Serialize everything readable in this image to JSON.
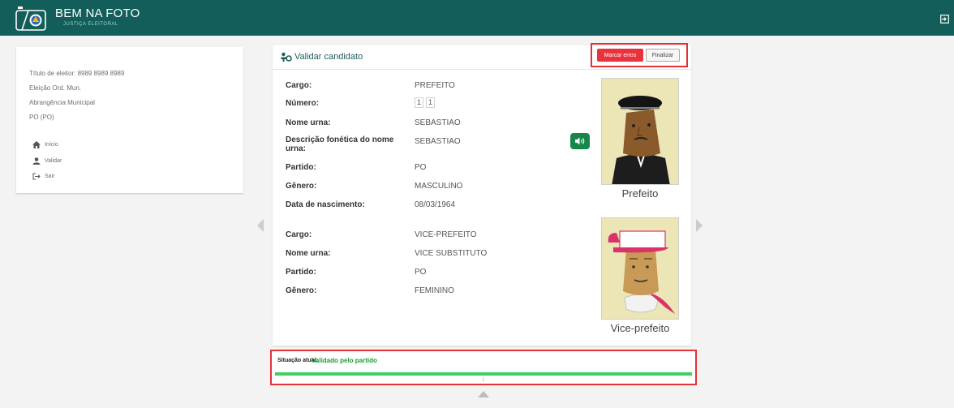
{
  "header": {
    "app_title": "BEM NA FOTO",
    "app_subtitle": "JUSTIÇA ELEITORAL",
    "exit_icon": "logout-icon",
    "bar_color": "#135e5a"
  },
  "sidebar": {
    "info": [
      "Título de eleitor: 8989 8989 8989",
      "Eleição Ord. Mun.",
      "Abrangência Municipal",
      "PO (PO)"
    ],
    "nav": [
      {
        "label": "Início",
        "icon": "home-icon"
      },
      {
        "label": "Validar",
        "icon": "user-icon"
      },
      {
        "label": "Sair",
        "icon": "logout-icon"
      }
    ]
  },
  "card": {
    "title": "Validar candidato",
    "title_icon": "people-icon",
    "buttons": {
      "marcar_erros": "Marcar erros",
      "finalizar": "Finalizar"
    },
    "prefeito": {
      "cargo_label": "Cargo:",
      "cargo_value": "PREFEITO",
      "numero_label": "Número:",
      "numero_digits": [
        "1",
        "1"
      ],
      "nome_label": "Nome urna:",
      "nome_value": "SEBASTIAO",
      "fonetica_label": "Descrição fonética do nome urna:",
      "fonetica_value": "SEBASTIAO",
      "partido_label": "Partido:",
      "partido_value": "PO",
      "genero_label": "Gênero:",
      "genero_value": "MASCULINO",
      "nascimento_label": "Data de nascimento:",
      "nascimento_value": "08/03/1964",
      "photo_caption": "Prefeito",
      "audio_icon": "speaker-icon"
    },
    "vice": {
      "cargo_label": "Cargo:",
      "cargo_value": "VICE-PREFEITO",
      "nome_label": "Nome urna:",
      "nome_value": "VICE SUBSTITUTO",
      "partido_label": "Partido:",
      "partido_value": "PO",
      "genero_label": "Gênero:",
      "genero_value": "FEMININO",
      "photo_caption": "Vice-prefeito"
    }
  },
  "status": {
    "label": "Situação atual:",
    "value": "Validado pelo partido",
    "page": "1",
    "color": "#1c9a31"
  },
  "colors": {
    "accent_red": "#e8333c",
    "progress_green": "#3fcf63"
  }
}
